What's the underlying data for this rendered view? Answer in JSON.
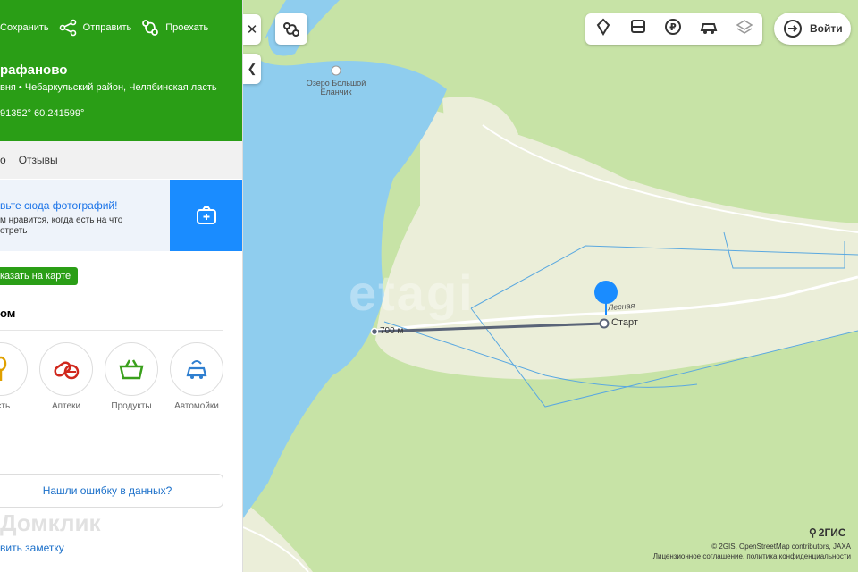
{
  "panel": {
    "actions": [
      {
        "label": "Сохранить",
        "icon": "star-icon"
      },
      {
        "label": "Отправить",
        "icon": "share-icon"
      },
      {
        "label": "Проехать",
        "icon": "route-icon"
      }
    ],
    "title": "рафаново",
    "subtitle": "вня • Чебаркульский район, Челябинская ласть",
    "coords": "91352° 60.241599°",
    "tabs": [
      "о",
      "Отзывы"
    ],
    "promo": {
      "title": "вьте сюда фотографий!",
      "text": "м нравится, когда есть на что отреть"
    },
    "show_on_map": "казать на карте",
    "nearby_title": "ом",
    "categories": [
      "есть",
      "Аптеки",
      "Продукты",
      "Автомойки"
    ],
    "error_link": "Нашли ошибку в данных?",
    "note_link": "вить заметку",
    "watermark": "Домклик"
  },
  "map": {
    "lake_label": "Озеро Большой Еланчик",
    "street_label": "Лесная",
    "start_label": "Старт",
    "distance_label": "700 м",
    "watermark": "etagi",
    "brand": "2ГИС",
    "copyright_line1": "© 2GIS, OpenStreetMap contributors, JAXA",
    "copyright_line2": "Лицензионное соглашение, политика конфиденциальности",
    "colors": {
      "water": "#8fcdee",
      "forest": "#c7e3a6",
      "land": "#ebeed9",
      "pin": "#1a8cff"
    }
  },
  "toolbar": {
    "login_label": "Войти"
  }
}
